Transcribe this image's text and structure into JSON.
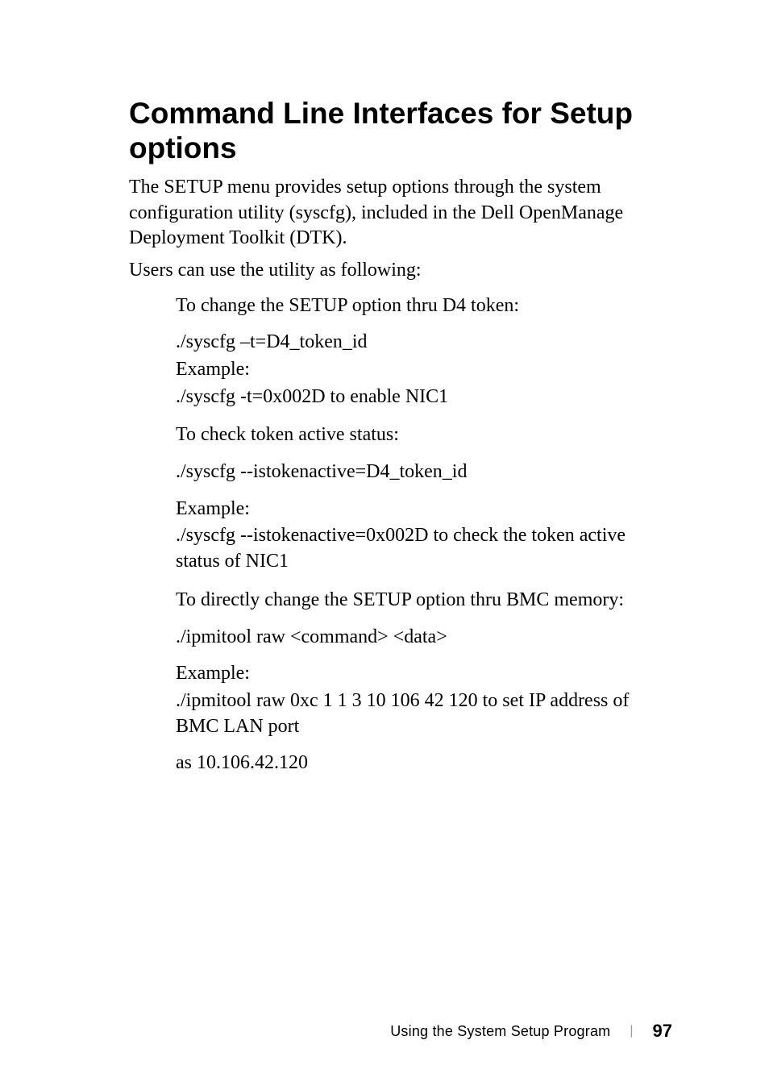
{
  "heading": "Command Line Interfaces for Setup options",
  "intro1": "The SETUP menu provides setup options through the system configuration utility (syscfg), included in the Dell OpenManage Deployment Toolkit (DTK).",
  "intro2": "Users can use the utility as following:",
  "sections": {
    "change_option": "To change the SETUP option thru D4 token:",
    "change_cmd_l1": "./syscfg –t=D4_token_id",
    "change_cmd_l2": "Example:",
    "change_cmd_l3": "./syscfg -t=0x002D to enable NIC1",
    "check_status": "To check token active status:",
    "check_cmd": "./syscfg --istokenactive=D4_token_id",
    "check_ex_l1": "Example:",
    "check_ex_l2": "./syscfg --istokenactive=0x002D to check the token active status of NIC1",
    "direct_change": "To directly change the SETUP option thru BMC memory:",
    "direct_cmd": "./ipmitool raw <command> <data>",
    "direct_ex_l1": "Example:",
    "direct_ex_l2": "./ipmitool raw 0xc 1 1 3 10 106 42 120 to set IP address of BMC LAN port",
    "direct_ex_l3": "as 10.106.42.120"
  },
  "footer": {
    "title": "Using the System Setup Program",
    "page": "97"
  }
}
